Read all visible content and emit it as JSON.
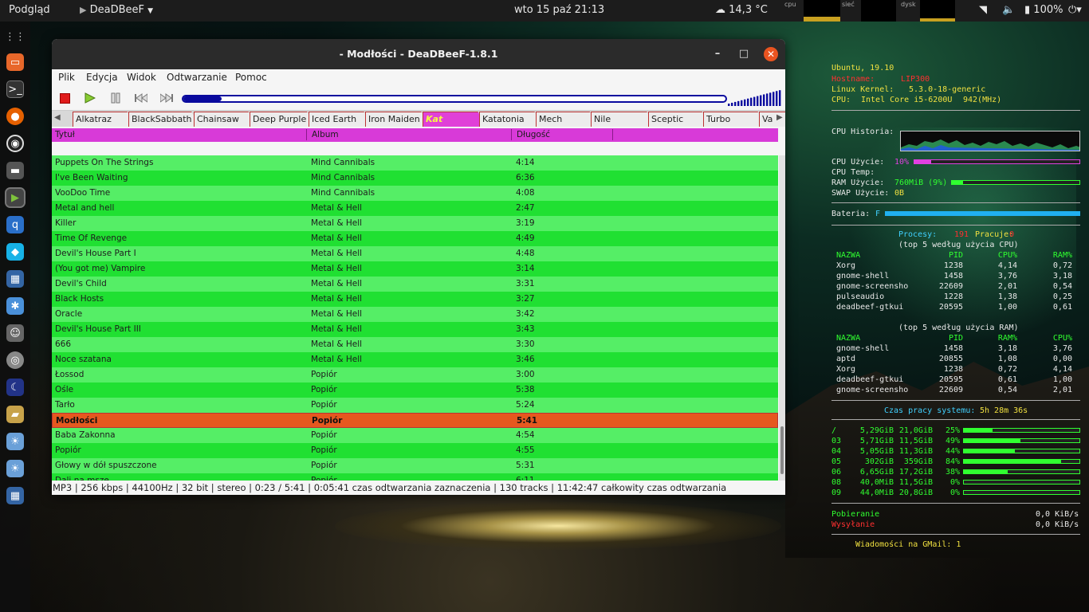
{
  "desktop": {
    "topbar": {
      "activities": "Podgląd",
      "app_name": "DeaDBeeF",
      "clock": "wto 15 paź  21:13",
      "weather": "14,3 °C",
      "graph_labels": [
        "cpu",
        "sieć",
        "dysk"
      ],
      "battery": "100%"
    },
    "dock_icons": [
      "apps-grid-icon",
      "files-icon",
      "terminal-icon",
      "firefox-icon",
      "obs-icon",
      "scanner-icon",
      "deadbeef-icon",
      "qbittorrent-icon",
      "kodi-icon",
      "calculator-icon",
      "network-icon",
      "user-icon",
      "disk-icon",
      "stellarium-icon",
      "folder-icon",
      "weather-icon",
      "weather-icon-2",
      "calculator-icon-2"
    ]
  },
  "window": {
    "title": "- Modłości - DeaDBeeF-1.8.1",
    "menu": [
      "Plik",
      "Edycja",
      "Widok",
      "Odtwarzanie",
      "Pomoc"
    ],
    "seek_fraction": 0.07,
    "tabs": [
      "Alkatraz",
      "BlackSabbath",
      "Chainsaw",
      "Deep Purple",
      "Iced Earth",
      "Iron Maiden",
      "Kat",
      "Katatonia",
      "Mech",
      "Nile",
      "Sceptic",
      "Turbo",
      "Va"
    ],
    "active_tab": "Kat",
    "columns": [
      "Tytuł",
      "Album",
      "Długość"
    ],
    "tracks": [
      {
        "title": "Puppets On The Strings",
        "album": "Mind Cannibals",
        "length": "4:14"
      },
      {
        "title": "I've Been Waiting",
        "album": "Mind Cannibals",
        "length": "6:36"
      },
      {
        "title": "VooDoo Time",
        "album": "Mind Cannibals",
        "length": "4:08"
      },
      {
        "title": "Metal and hell",
        "album": "Metal & Hell",
        "length": "2:47"
      },
      {
        "title": "Killer",
        "album": "Metal & Hell",
        "length": "3:19"
      },
      {
        "title": "Time Of Revenge",
        "album": "Metal & Hell",
        "length": "4:49"
      },
      {
        "title": "Devil's House Part I",
        "album": "Metal & Hell",
        "length": "4:48"
      },
      {
        "title": "(You got me) Vampire",
        "album": "Metal & Hell",
        "length": "3:14"
      },
      {
        "title": "Devil's Child",
        "album": "Metal & Hell",
        "length": "3:31"
      },
      {
        "title": "Black Hosts",
        "album": "Metal & Hell",
        "length": "3:27"
      },
      {
        "title": "Oracle",
        "album": "Metal & Hell",
        "length": "3:42"
      },
      {
        "title": "Devil's House Part III",
        "album": "Metal & Hell",
        "length": "3:43"
      },
      {
        "title": "666",
        "album": "Metal & Hell",
        "length": "3:30"
      },
      {
        "title": "Noce szatana",
        "album": "Metal & Hell",
        "length": "3:46"
      },
      {
        "title": "Łossod",
        "album": "Popiór",
        "length": "3:00"
      },
      {
        "title": "Ośle",
        "album": "Popiór",
        "length": "5:38"
      },
      {
        "title": "Tarło",
        "album": "Popiór",
        "length": "5:24"
      },
      {
        "title": "Modłości",
        "album": "Popiór",
        "length": "5:41"
      },
      {
        "title": "Baba Zakonna",
        "album": "Popiór",
        "length": "4:54"
      },
      {
        "title": "Popiór",
        "album": "Popiór",
        "length": "4:55"
      },
      {
        "title": "Głowy w dół spuszczone",
        "album": "Popiór",
        "length": "5:31"
      },
      {
        "title": "Dali na mszę",
        "album": "Popiór",
        "length": "6:11"
      }
    ],
    "selected_index": 17,
    "status": "MP3 | 256 kbps | 44100Hz | 32 bit | stereo | 0:23 / 5:41 | 0:05:41 czas odtwarzania zaznaczenia | 130 tracks | 11:42:47 całkowity czas odtwarzania"
  },
  "conky": {
    "os": "Ubuntu, 19.10",
    "hostname_label": "Hostname:",
    "hostname": "LIP300",
    "kernel_label": "Linux Kernel:",
    "kernel": "5.3.0-18-generic",
    "cpu_label": "CPU:",
    "cpu_model": "Intel Core i5-6200U",
    "cpu_freq": "942(MHz)",
    "cpu_history_label": "CPU Historia:",
    "cpu_use_label": "CPU  Użycie:",
    "cpu_use": "10%",
    "cpu_use_fraction": 0.1,
    "cpu_temp_label": "CPU  Temp:",
    "ram_label": "RAM  Użycie:",
    "ram_use": "760MiB (9%)",
    "ram_fraction": 0.09,
    "swap_label": "SWAP Użycie:",
    "swap_use": "0B",
    "battery_label": "Bateria:",
    "battery_state": "F",
    "battery_fraction": 1.0,
    "proc_label": "Procesy:",
    "proc_count": "191",
    "running_label": "Pracuje:",
    "running": "0",
    "top_cpu_title": "(top 5 według użycia CPU)",
    "top_cpu_headers": [
      "NAZWA",
      "PID",
      "CPU%",
      "RAM%"
    ],
    "top_cpu": [
      [
        "Xorg",
        "1238",
        "4,14",
        "0,72"
      ],
      [
        "gnome-shell",
        "1458",
        "3,76",
        "3,18"
      ],
      [
        "gnome-screensho",
        "22609",
        "2,01",
        "0,54"
      ],
      [
        "pulseaudio",
        "1228",
        "1,38",
        "0,25"
      ],
      [
        "deadbeef-gtkui",
        "20595",
        "1,00",
        "0,61"
      ]
    ],
    "top_ram_title": "(top 5 według użycia RAM)",
    "top_ram_headers": [
      "NAZWA",
      "PID",
      "RAM%",
      "CPU%"
    ],
    "top_ram": [
      [
        "gnome-shell",
        "1458",
        "3,18",
        "3,76"
      ],
      [
        "aptd",
        "20855",
        "1,08",
        "0,00"
      ],
      [
        "Xorg",
        "1238",
        "0,72",
        "4,14"
      ],
      [
        "deadbeef-gtkui",
        "20595",
        "0,61",
        "1,00"
      ],
      [
        "gnome-screensho",
        "22609",
        "0,54",
        "2,01"
      ]
    ],
    "uptime_label": "Czas pracy systemu:",
    "uptime": "5h 28m 36s",
    "disks": [
      [
        "/",
        "5,29GiB",
        "21,0GiB",
        "25%",
        0.25
      ],
      [
        "03",
        "5,71GiB",
        "11,5GiB",
        "49%",
        0.49
      ],
      [
        "04",
        "5,05GiB",
        "11,3GiB",
        "44%",
        0.44
      ],
      [
        "05",
        "302GiB",
        "359GiB",
        "84%",
        0.84
      ],
      [
        "06",
        "6,65GiB",
        "17,2GiB",
        "38%",
        0.38
      ],
      [
        "08",
        "40,0MiB",
        "11,5GiB",
        "0%",
        0.0
      ],
      [
        "09",
        "44,0MiB",
        "20,8GiB",
        "0%",
        0.0
      ]
    ],
    "download_label": "Pobieranie",
    "download": "0,0 KiB/s",
    "upload_label": "Wysyłanie",
    "upload": "0,0 KiB/s",
    "gmail": "Wiadomości na GMail: 1"
  }
}
